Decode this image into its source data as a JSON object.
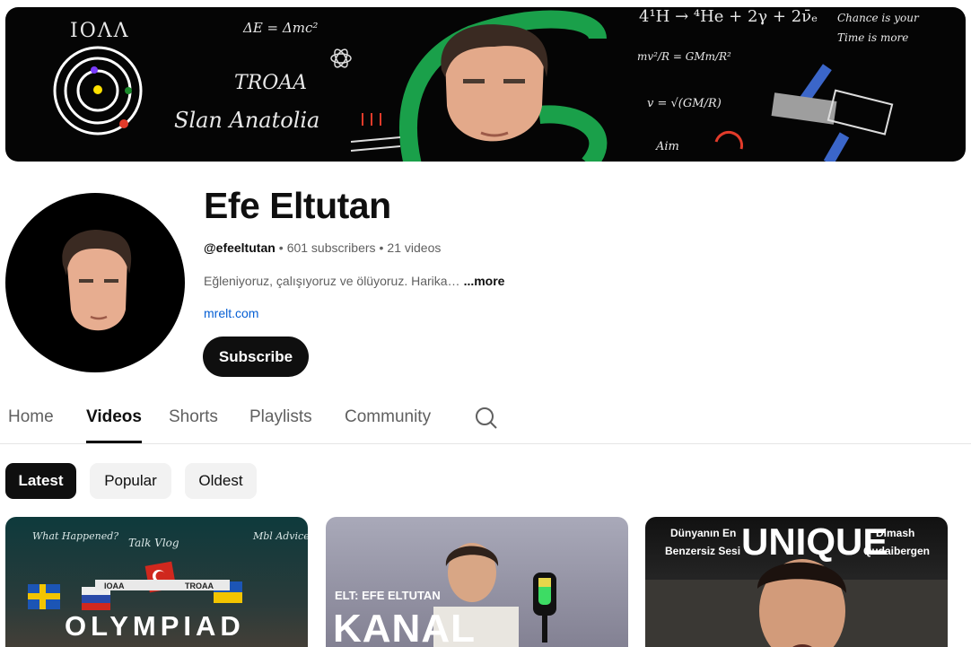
{
  "banner": {
    "scribbles": {
      "ioaa": "IOΛΛ",
      "equation_e": "ΔE = Δmc²",
      "troaa": "TROAA",
      "signature": "Slan Anatolia",
      "fusion": "4¹H → ⁴He + 2γ + 2ν̄ₑ",
      "quote_line1": "Chance is your",
      "quote_line2": "Time is more",
      "gravity": "mv²/R = GMm/R²",
      "velocity": "v = √(GM/R)",
      "aim": "Aim"
    }
  },
  "channel": {
    "name": "Efe Eltutan",
    "handle": "@efeeltutan",
    "subscribers": "601 subscribers",
    "videos": "21 videos",
    "description": "Eğleniyoruz, çalışıyoruz ve ölüyoruz. Harika…",
    "more_label": "...more",
    "link": "mrelt.com",
    "subscribe_label": "Subscribe"
  },
  "tabs": {
    "home": "Home",
    "videos": "Videos",
    "shorts": "Shorts",
    "playlists": "Playlists",
    "community": "Community",
    "search_icon": "search-icon"
  },
  "chips": {
    "latest": "Latest",
    "popular": "Popular",
    "oldest": "Oldest"
  },
  "videos": [
    {
      "big_title": "OLYMPIAD",
      "overlay_1": "What Happened?",
      "overlay_2": "Talk Vlog",
      "overlay_3": "Mbl Advices",
      "overlay_4": "IOAA",
      "overlay_5": "TROAA"
    },
    {
      "label": "ELT: EFE ELTUTAN",
      "big_title": "KANAL"
    },
    {
      "left_caption_1": "Dünyanın En",
      "left_caption_2": "Benzersiz Sesi",
      "big_title": "UNIQUE",
      "right_caption_1": "Dimash",
      "right_caption_2": "Qudaibergen"
    }
  ],
  "colors": {
    "accent_dark": "#0f0f0f",
    "link_blue": "#065fd4",
    "chip_bg": "#f2f2f2",
    "muted_text": "#606060"
  }
}
